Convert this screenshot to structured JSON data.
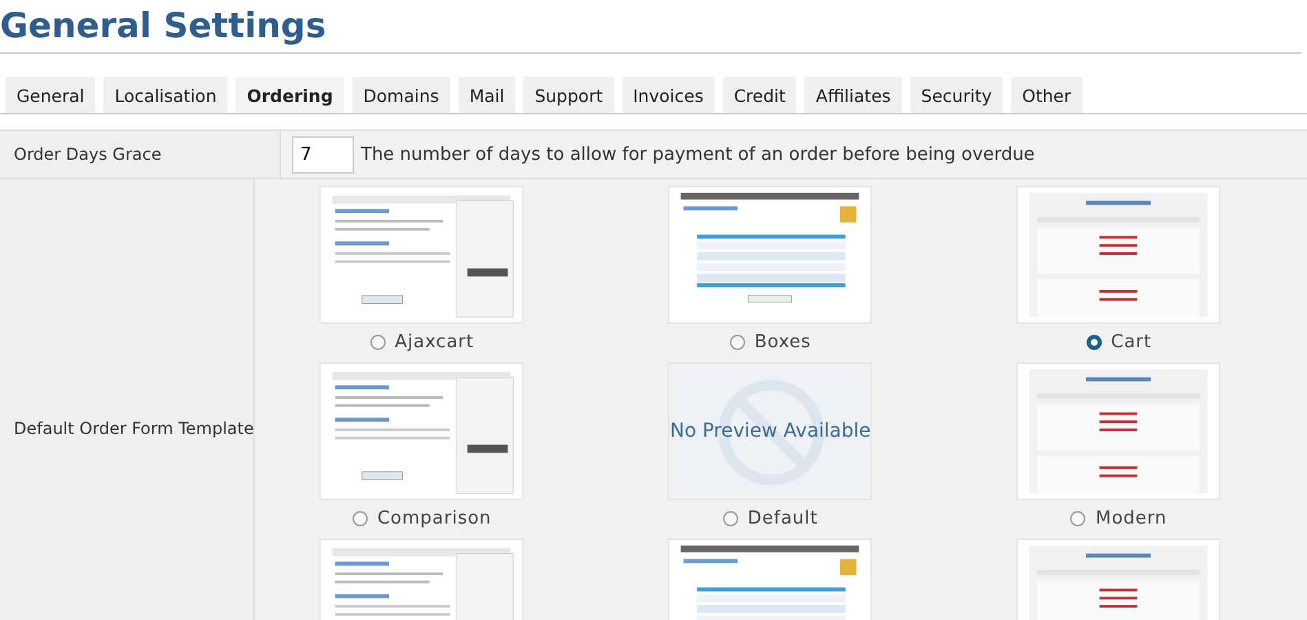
{
  "title": "General Settings",
  "tabs": [
    {
      "label": "General",
      "selected": false
    },
    {
      "label": "Localisation",
      "selected": false
    },
    {
      "label": "Ordering",
      "selected": true
    },
    {
      "label": "Domains",
      "selected": false
    },
    {
      "label": "Mail",
      "selected": false
    },
    {
      "label": "Support",
      "selected": false
    },
    {
      "label": "Invoices",
      "selected": false
    },
    {
      "label": "Credit",
      "selected": false
    },
    {
      "label": "Affiliates",
      "selected": false
    },
    {
      "label": "Security",
      "selected": false
    },
    {
      "label": "Other",
      "selected": false
    }
  ],
  "order_days_grace": {
    "label": "Order Days Grace",
    "value": "7",
    "help": "The number of days to allow for payment of an order before being overdue"
  },
  "order_form_template": {
    "label": "Default Order Form Template",
    "templates": [
      {
        "name": "Ajaxcart",
        "selected": false,
        "kind": "thumbnail"
      },
      {
        "name": "Boxes",
        "selected": false,
        "kind": "thumbnail"
      },
      {
        "name": "Cart",
        "selected": true,
        "kind": "thumbnail"
      },
      {
        "name": "Comparison",
        "selected": false,
        "kind": "thumbnail"
      },
      {
        "name": "Default",
        "selected": false,
        "kind": "placeholder",
        "preview_text": "No Preview Available"
      },
      {
        "name": "Modern",
        "selected": false,
        "kind": "thumbnail"
      },
      {
        "kind": "thumbnail"
      },
      {
        "kind": "thumbnail"
      },
      {
        "kind": "thumbnail"
      }
    ]
  }
}
